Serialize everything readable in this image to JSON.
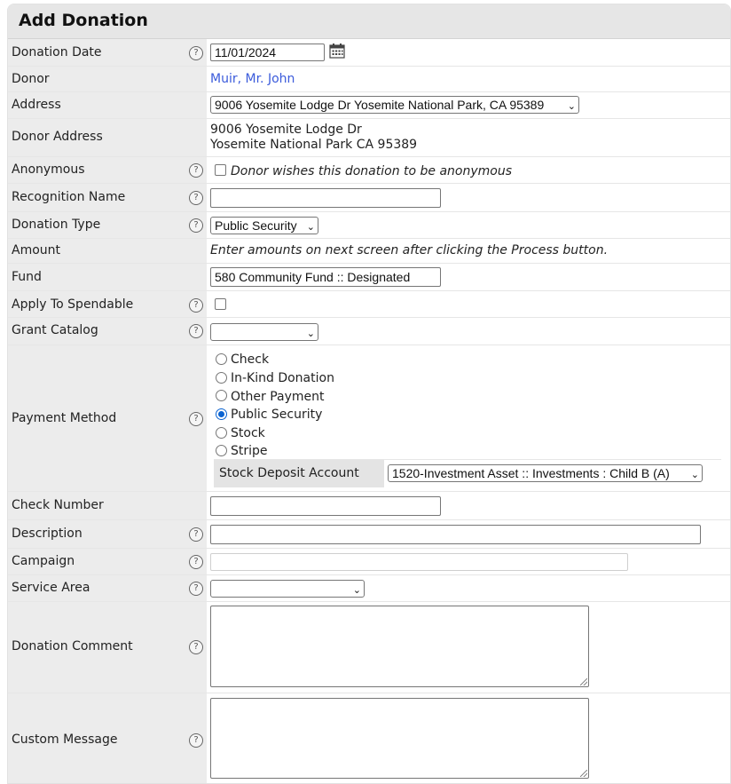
{
  "title": "Add Donation",
  "help_glyph": "?",
  "fields": {
    "donation_date": {
      "label": "Donation Date",
      "value": "11/01/2024"
    },
    "donor": {
      "label": "Donor",
      "value": "Muir, Mr. John"
    },
    "address": {
      "label": "Address",
      "value": "9006 Yosemite Lodge Dr Yosemite National Park, CA 95389"
    },
    "donor_address": {
      "label": "Donor Address",
      "line1": "9006 Yosemite Lodge Dr",
      "line2": "Yosemite National Park CA 95389"
    },
    "anonymous": {
      "label": "Anonymous",
      "checkbox_label": "Donor wishes this donation to be anonymous",
      "checked": false
    },
    "recognition_name": {
      "label": "Recognition Name",
      "value": ""
    },
    "donation_type": {
      "label": "Donation Type",
      "value": "Public Security"
    },
    "amount": {
      "label": "Amount",
      "note": "Enter amounts on next screen after clicking the Process button."
    },
    "fund": {
      "label": "Fund",
      "value": "580 Community Fund :: Designated"
    },
    "apply_to_spendable": {
      "label": "Apply To Spendable",
      "checked": false
    },
    "grant_catalog": {
      "label": "Grant Catalog",
      "value": ""
    },
    "payment_method": {
      "label": "Payment Method",
      "options": [
        "Check",
        "In-Kind Donation",
        "Other Payment",
        "Public Security",
        "Stock",
        "Stripe"
      ],
      "selected": "Public Security",
      "stock_deposit_label": "Stock Deposit Account",
      "stock_deposit_value": "1520-Investment Asset :: Investments : Child B (A)"
    },
    "check_number": {
      "label": "Check Number",
      "value": ""
    },
    "description": {
      "label": "Description",
      "value": ""
    },
    "campaign": {
      "label": "Campaign",
      "value": ""
    },
    "service_area": {
      "label": "Service Area",
      "value": ""
    },
    "donation_comment": {
      "label": "Donation Comment",
      "value": ""
    },
    "custom_message": {
      "label": "Custom Message",
      "value": ""
    }
  },
  "icons": {
    "calendar": "calendar-icon",
    "help": "help-icon",
    "dropdown": "chevron-down-icon"
  },
  "colors": {
    "label_bg": "#ececec",
    "link": "#3b5bdb",
    "radio_selected": "#0b63d1"
  }
}
